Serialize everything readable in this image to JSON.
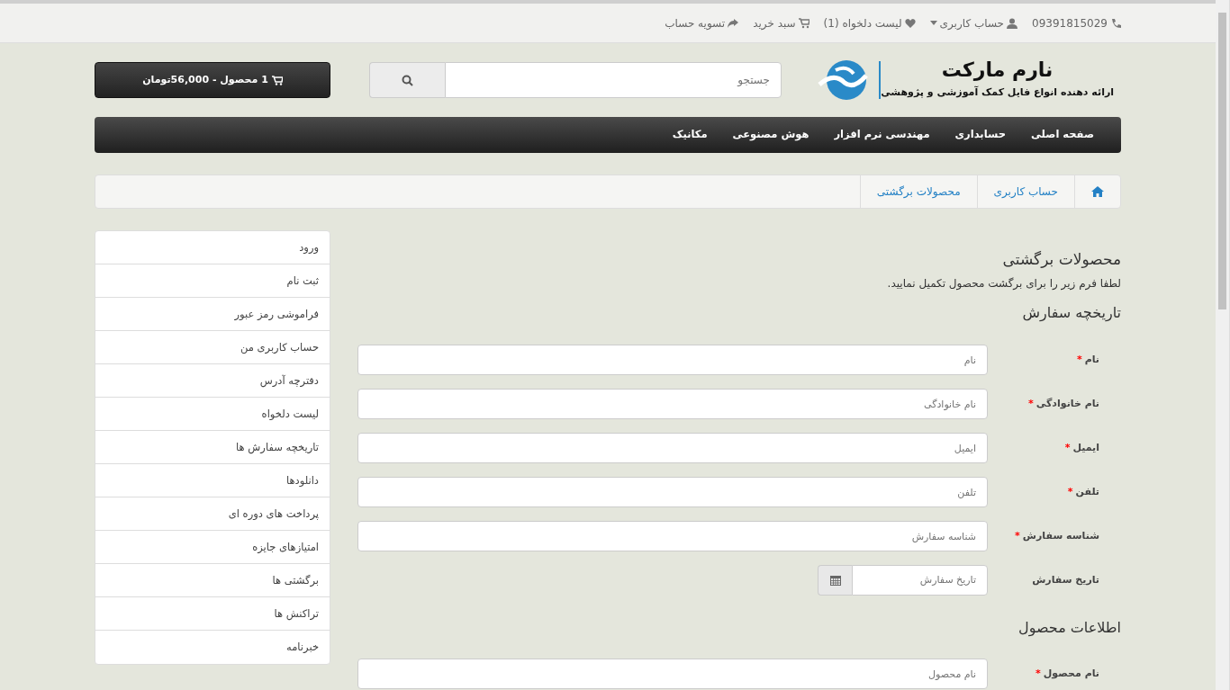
{
  "topbar": {
    "phone": "09391815029",
    "account": "حساب کاربری",
    "wishlist": "لیست دلخواه (1)",
    "cart": "سبد خرید",
    "checkout": "تسویه حساب"
  },
  "logo": {
    "name": "نارم مارکت",
    "tagline": "ارائه دهنده انواع فایل کمک آموزشی و پژوهشی"
  },
  "search": {
    "placeholder": "جستجو"
  },
  "cart_button": "1 محصول - 56,000تومان",
  "menu": [
    "صفحه اصلی",
    "حسابداری",
    "مهندسی نرم افزار",
    "هوش مصنوعی",
    "مکانیک"
  ],
  "breadcrumb": [
    "حساب کاربری",
    "محصولات برگشتی"
  ],
  "page_title": "محصولات برگشتی",
  "intro": "لطفا فرم زیر را برای برگشت محصول تکمیل نمایید.",
  "required_mark": "*",
  "sections": [
    {
      "title": "تاریخچه سفارش",
      "fields": [
        {
          "label": "نام",
          "placeholder": "نام",
          "required": true,
          "kind": "text"
        },
        {
          "label": "نام خانوادگی",
          "placeholder": "نام خانوادگی",
          "required": true,
          "kind": "text"
        },
        {
          "label": "ایمیل",
          "placeholder": "ایمیل",
          "required": true,
          "kind": "text"
        },
        {
          "label": "تلفن",
          "placeholder": "تلفن",
          "required": true,
          "kind": "text"
        },
        {
          "label": "شناسه سفارش",
          "placeholder": "شناسه سفارش",
          "required": true,
          "kind": "text"
        },
        {
          "label": "تاریخ سفارش",
          "placeholder": "تاریخ سفارش",
          "required": false,
          "kind": "date"
        }
      ]
    },
    {
      "title": "اطلاعات محصول",
      "fields": [
        {
          "label": "نام محصول",
          "placeholder": "نام محصول",
          "required": true,
          "kind": "text"
        }
      ]
    }
  ],
  "sidebar": {
    "items": [
      "ورود",
      "ثبت نام",
      "فراموشی رمز عبور",
      "حساب کاربری من",
      "دفترچه آدرس",
      "لیست دلخواه",
      "تاریخچه سفارش ها",
      "دانلودها",
      "پرداخت های دوره ای",
      "امتیازهای جایزه",
      "برگشتی ها",
      "تراکنش ها",
      "خبرنامه"
    ]
  }
}
